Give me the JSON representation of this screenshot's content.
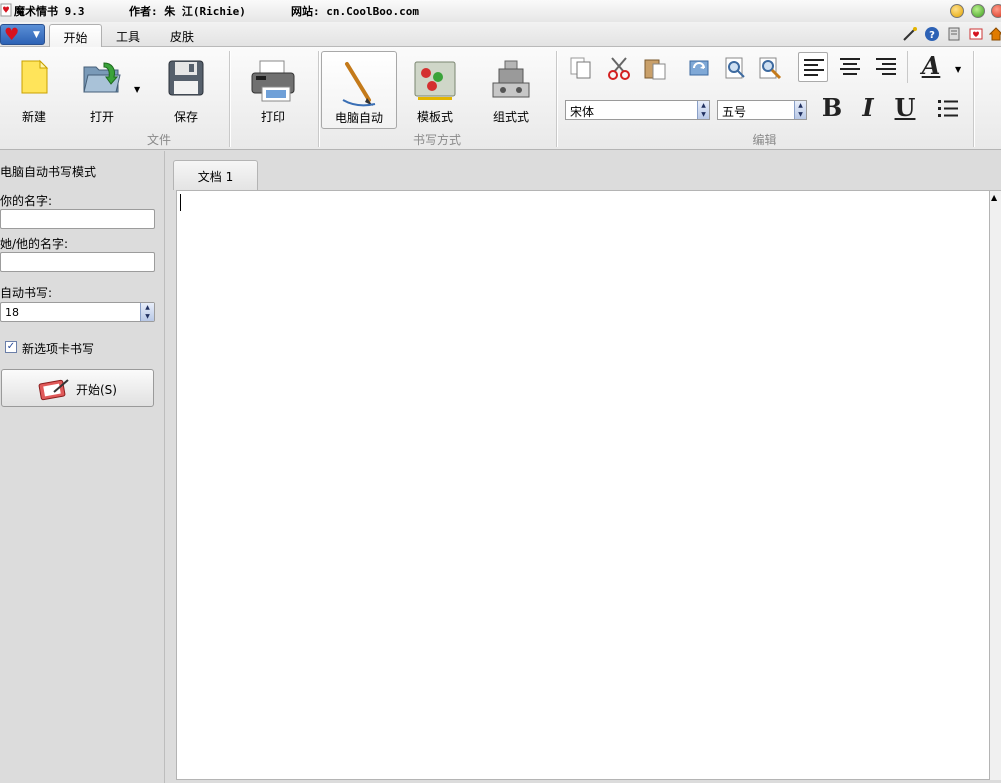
{
  "window": {
    "app_name": "魔术情书 9.3",
    "author": "作者: 朱 江(Richie)",
    "website": "网站: cn.CoolBoo.com"
  },
  "ribbon_tabs": [
    "开始",
    "工具",
    "皮肤"
  ],
  "ribbon": {
    "groups": {
      "file": "文件",
      "writing_mode": "书写方式",
      "edit": "编辑"
    },
    "buttons": {
      "new": "新建",
      "open": "打开",
      "save": "保存",
      "print": "打印",
      "auto": "电脑自动",
      "template": "模板式",
      "assembly": "组式式"
    },
    "font_name": "宋体",
    "font_size": "五号",
    "format": {
      "bold": "B",
      "italic": "I",
      "underline": "U",
      "font_color": "A"
    }
  },
  "left_panel": {
    "title": "电脑自动书写模式",
    "your_name_label": "你的名字:",
    "your_name_value": "",
    "their_name_label": "她/他的名字:",
    "their_name_value": "",
    "auto_write_label": "自动书写:",
    "auto_write_value": "18",
    "new_tab_label": "新选项卡书写",
    "new_tab_checked": true,
    "start_button": "开始(S)"
  },
  "document": {
    "tab_title": "文档 1",
    "content": ""
  },
  "colors": {
    "accent_blue": "#2d62b5",
    "heart_red": "#d6121e",
    "panel_gray": "#dcdcdc"
  }
}
